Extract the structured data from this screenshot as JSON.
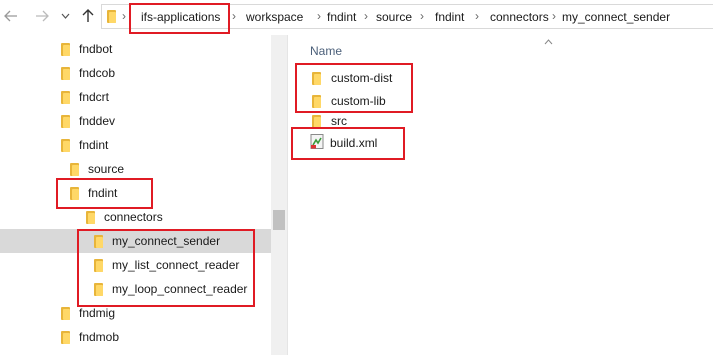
{
  "nav": {
    "back_icon": "arrow-left-icon",
    "forward_icon": "arrow-right-icon",
    "recent_icon": "chevron-down-icon",
    "up_icon": "arrow-up-icon"
  },
  "breadcrumb": [
    "ifs-applications",
    "workspace",
    "fndint",
    "source",
    "fndint",
    "connectors",
    "my_connect_sender"
  ],
  "tree": [
    {
      "label": "fndbot"
    },
    {
      "label": "fndcob"
    },
    {
      "label": "fndcrt"
    },
    {
      "label": "fnddev"
    },
    {
      "label": "fndint"
    },
    {
      "label": "source"
    },
    {
      "label": "fndint"
    },
    {
      "label": "connectors"
    },
    {
      "label": "my_connect_sender"
    },
    {
      "label": "my_list_connect_reader"
    },
    {
      "label": "my_loop_connect_reader"
    },
    {
      "label": "fndmig"
    },
    {
      "label": "fndmob"
    }
  ],
  "content": {
    "column_header": "Name",
    "items": [
      {
        "label": "custom-dist",
        "icon": "folder-icon"
      },
      {
        "label": "custom-lib",
        "icon": "folder-icon"
      },
      {
        "label": "src",
        "icon": "folder-icon"
      },
      {
        "label": "build.xml",
        "icon": "xml-file-icon"
      }
    ]
  },
  "colors": {
    "highlight_box": "#e01b24",
    "selection": "#d9d9d9",
    "folder": "#ffd867"
  }
}
